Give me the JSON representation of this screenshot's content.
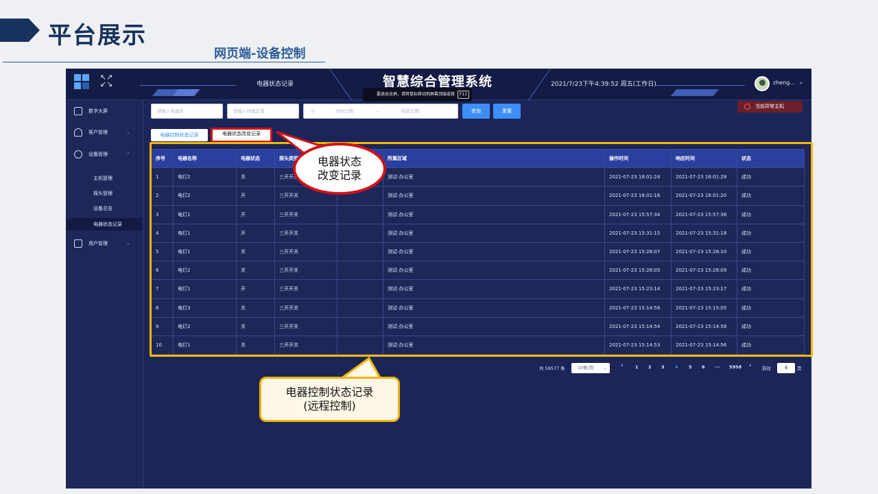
{
  "slide": {
    "title": "平台展示",
    "subtitle": "网页端-设备控制"
  },
  "app": {
    "topbar": {
      "tab_label": "电器状态记录",
      "system_title": "智慧综合管理系统",
      "fullscreen_tip": "要退出全屏，请将鼠标移动到屏幕顶端或按",
      "fullscreen_key": "F11",
      "datetime": "2021/7/23下午4:39:52 周五(工作日)",
      "username": "zheng..."
    },
    "sidebar": {
      "items": [
        {
          "label": "数字大屏",
          "icon": "monitor-icon"
        },
        {
          "label": "客户管理",
          "icon": "user-icon"
        },
        {
          "label": "设备管理",
          "icon": "cloud-icon"
        },
        {
          "label": "用户管理",
          "icon": "id-card-icon"
        }
      ],
      "sub_items": [
        "主机管理",
        "探头管理",
        "设备总览",
        "电器状态记录"
      ]
    },
    "filters": {
      "name_placeholder": "请输入电器名",
      "area_placeholder": "请输入所属区域",
      "start_date": "开始日期",
      "date_sep": "-",
      "end_date": "结束日期",
      "query_label": "查询",
      "reset_label": "重置",
      "alarm_label": "当前异常主机"
    },
    "tabs": {
      "control_record": "电器控制状态记录",
      "change_record": "电器状态改变记录"
    },
    "table": {
      "headers": [
        "序号",
        "电器名称",
        "电器状态",
        "探头类型",
        "",
        "所属区域",
        "操作时间",
        "响应时间",
        "状态"
      ],
      "rows": [
        [
          "1",
          "电灯2",
          "关",
          "三开开关",
          "",
          "测试-办公室",
          "2021-07-23 16:01:24",
          "2021-07-23 16:01:28",
          "成功"
        ],
        [
          "2",
          "电灯2",
          "开",
          "三开开关",
          "",
          "测试-办公室",
          "2021-07-23 16:01:16",
          "2021-07-23 16:01:20",
          "成功"
        ],
        [
          "3",
          "电灯1",
          "开",
          "三开开关",
          "",
          "测试-办公室",
          "2021-07-23 15:57:34",
          "2021-07-23 15:57:38",
          "成功"
        ],
        [
          "4",
          "电灯1",
          "开",
          "三开开关",
          "",
          "测试-办公室",
          "2021-07-23 15:31:15",
          "2021-07-23 15:31:18",
          "成功"
        ],
        [
          "5",
          "电灯1",
          "关",
          "三开开关",
          "",
          "测试-办公室",
          "2021-07-23 15:28:07",
          "2021-07-23 15:28:10",
          "成功"
        ],
        [
          "6",
          "电灯2",
          "关",
          "三开开关",
          "",
          "测试-办公室",
          "2021-07-23 15:28:05",
          "2021-07-23 15:28:09",
          "成功"
        ],
        [
          "7",
          "电灯1",
          "开",
          "三开开关",
          "",
          "测试-办公室",
          "2021-07-23 15:23:14",
          "2021-07-23 15:23:17",
          "成功"
        ],
        [
          "8",
          "电灯3",
          "关",
          "三开开关",
          "",
          "测试-办公室",
          "2021-07-23 15:14:56",
          "2021-07-23 15:15:05",
          "成功"
        ],
        [
          "9",
          "电灯2",
          "关",
          "三开开关",
          "",
          "测试-办公室",
          "2021-07-23 15:14:54",
          "2021-07-23 15:14:58",
          "成功"
        ],
        [
          "10",
          "电灯1",
          "关",
          "三开开关",
          "",
          "测试-办公室",
          "2021-07-23 15:14:53",
          "2021-07-23 15:14:56",
          "成功"
        ]
      ]
    },
    "pager": {
      "total": "共 59577 条",
      "page_size": "10条/页",
      "prev": "‹",
      "pages": [
        "1",
        "2",
        "3",
        "4",
        "5",
        "6",
        "···",
        "5958"
      ],
      "current": "4",
      "next": "›",
      "goto_label": "前往",
      "goto_value": "4",
      "page_unit": "页"
    }
  },
  "callouts": {
    "red_line1": "电器状态",
    "red_line2": "改变记录",
    "yellow_line1": "电器控制状态记录",
    "yellow_line2": "(远程控制)"
  },
  "colors": {
    "slide_navy": "#17325c",
    "app_bg": "#1b2557",
    "accent_blue": "#3e8ef7",
    "highlight_red": "#d01218",
    "highlight_yellow": "#f4b900"
  }
}
